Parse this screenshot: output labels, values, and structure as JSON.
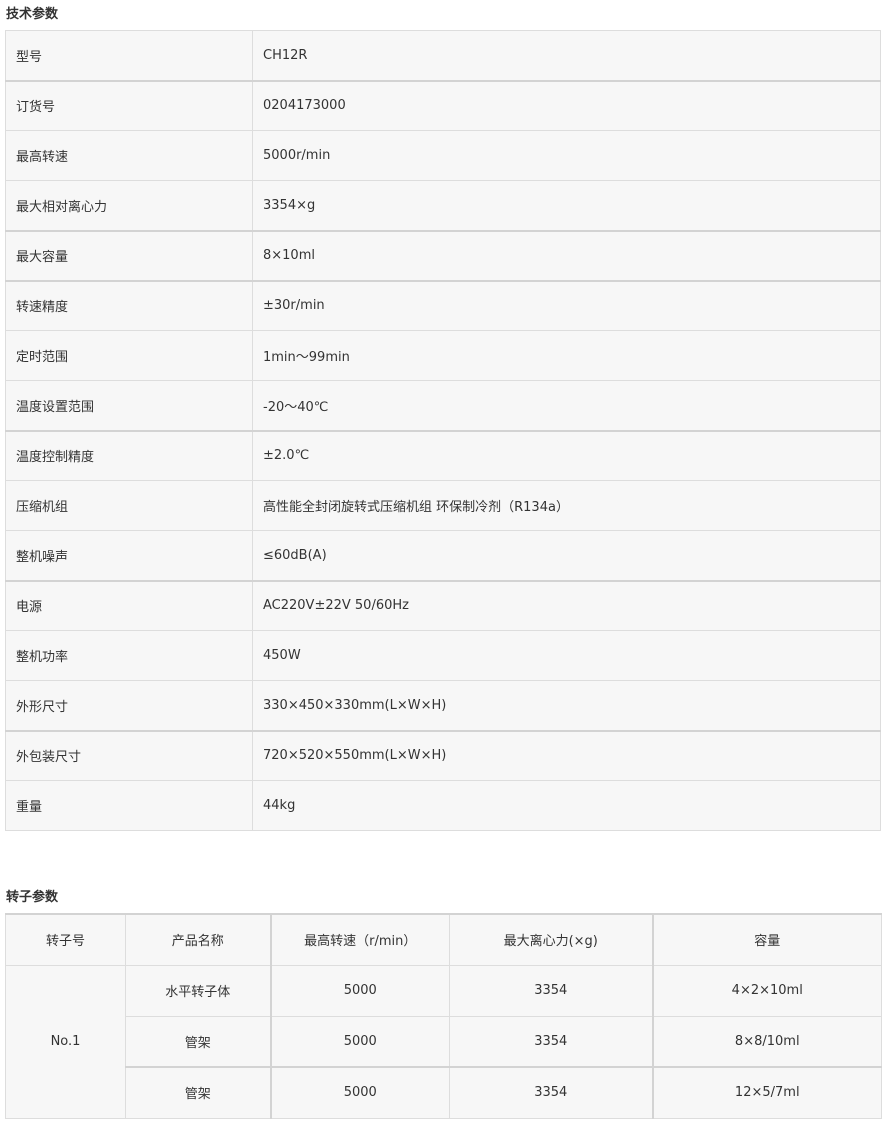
{
  "specs": {
    "title": "技术参数",
    "rows": [
      {
        "key": "型号",
        "value": "CH12R"
      },
      {
        "key": "订货号",
        "value": "0204173000"
      },
      {
        "key": "最高转速",
        "value": "5000r/min"
      },
      {
        "key": "最大相对离心力",
        "value": "3354×g"
      },
      {
        "key": "最大容量",
        "value": "8×10ml"
      },
      {
        "key": "转速精度",
        "value": "±30r/min"
      },
      {
        "key": "定时范围",
        "value": "1min～99min"
      },
      {
        "key": "温度设置范围",
        "value": "-20～40℃"
      },
      {
        "key": "温度控制精度",
        "value": "±2.0℃"
      },
      {
        "key": "压缩机组",
        "value": "高性能全封闭旋转式压缩机组 环保制冷剂（R134a）"
      },
      {
        "key": "整机噪声",
        "value": "≤60dB(A)"
      },
      {
        "key": "电源",
        "value": "AC220V±22V 50/60Hz"
      },
      {
        "key": "整机功率",
        "value": "450W"
      },
      {
        "key": "外形尺寸",
        "value": "330×450×330mm(L×W×H)"
      },
      {
        "key": "外包装尺寸",
        "value": "720×520×550mm(L×W×H)"
      },
      {
        "key": "重量",
        "value": "44kg"
      }
    ]
  },
  "rotor": {
    "title": "转子参数",
    "headers": [
      "转子号",
      "产品名称",
      "最高转速（r/min）",
      "最大离心力(×g)",
      "容量"
    ],
    "rotor_no": "No.1",
    "rows": [
      {
        "name": "水平转子体",
        "speed": "5000",
        "force": "3354",
        "capacity": "4×2×10ml"
      },
      {
        "name": "管架",
        "speed": "5000",
        "force": "3354",
        "capacity": "8×8/10ml"
      },
      {
        "name": "管架",
        "speed": "5000",
        "force": "3354",
        "capacity": "12×5/7ml"
      }
    ]
  }
}
